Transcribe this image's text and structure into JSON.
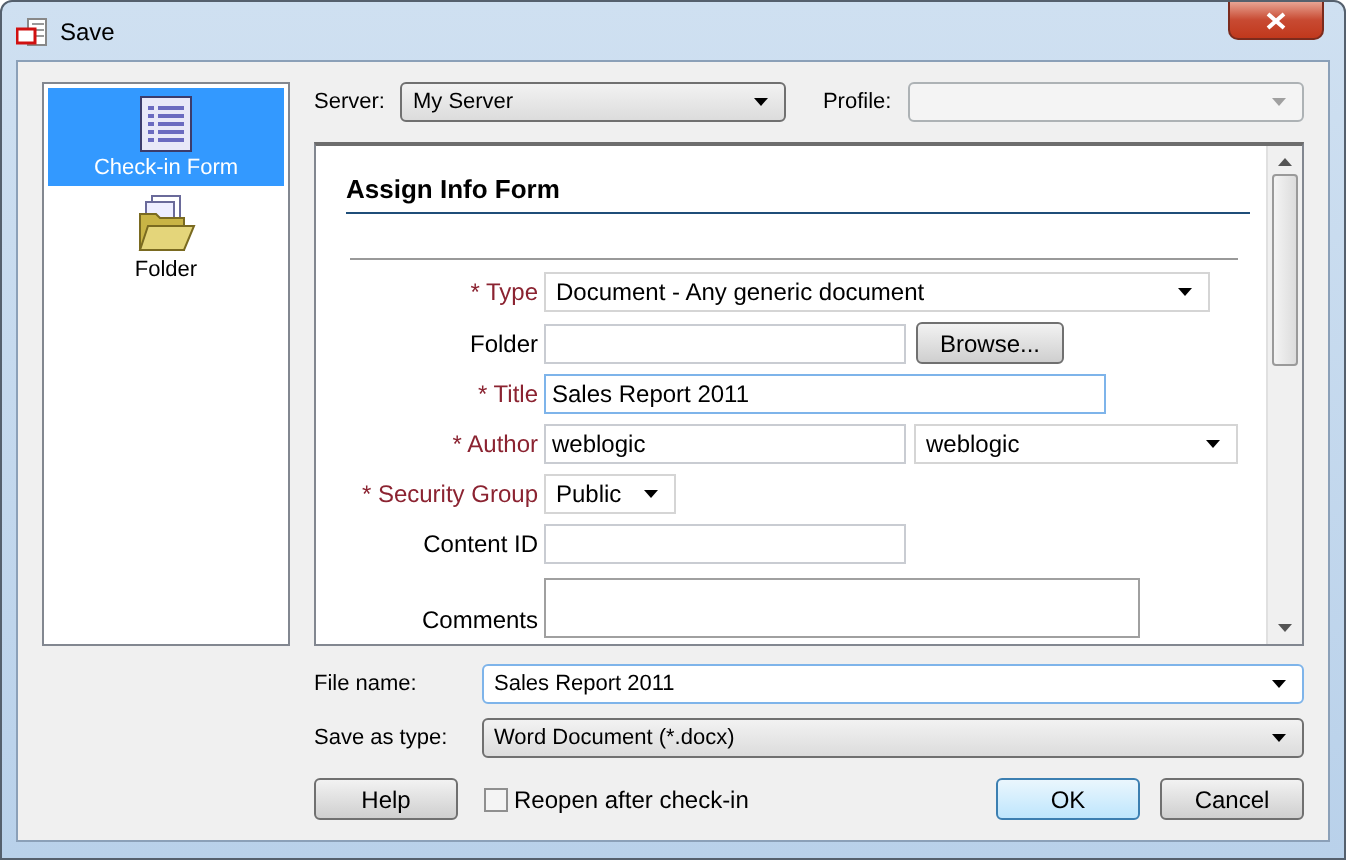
{
  "window": {
    "title": "Save"
  },
  "sidebar": {
    "items": [
      {
        "label": "Check-in Form",
        "selected": true
      },
      {
        "label": "Folder",
        "selected": false
      }
    ]
  },
  "server": {
    "label": "Server:",
    "value": "My Server"
  },
  "profile": {
    "label": "Profile:",
    "disabled": true
  },
  "form": {
    "heading": "Assign Info Form",
    "fields": [
      {
        "kind": "select",
        "marker": "*",
        "label": "Type",
        "value": "Document - Any generic document"
      },
      {
        "kind": "browse",
        "label": "Folder",
        "button": "Browse..."
      },
      {
        "kind": "text",
        "marker": "*",
        "label": "Title",
        "value": "Sales Report 2011",
        "focused": true
      },
      {
        "kind": "text_select",
        "marker": "*",
        "label": "Author",
        "value": "weblogic",
        "select_value": "weblogic"
      },
      {
        "kind": "small_select",
        "marker": "*",
        "label": "Security Group",
        "value": "Public"
      },
      {
        "kind": "short_text",
        "label": "Content ID"
      },
      {
        "kind": "textarea",
        "label": "Comments"
      }
    ]
  },
  "file_name": {
    "label": "File name:",
    "value": "Sales Report 2011"
  },
  "save_as_type": {
    "label": "Save as type:",
    "value": "Word Document (*.docx)"
  },
  "help_button": "Help",
  "reopen": {
    "label": "Reopen after check-in",
    "checked": false
  },
  "buttons": [
    {
      "label": "OK",
      "default": true
    },
    {
      "label": "Cancel",
      "default": false
    }
  ]
}
